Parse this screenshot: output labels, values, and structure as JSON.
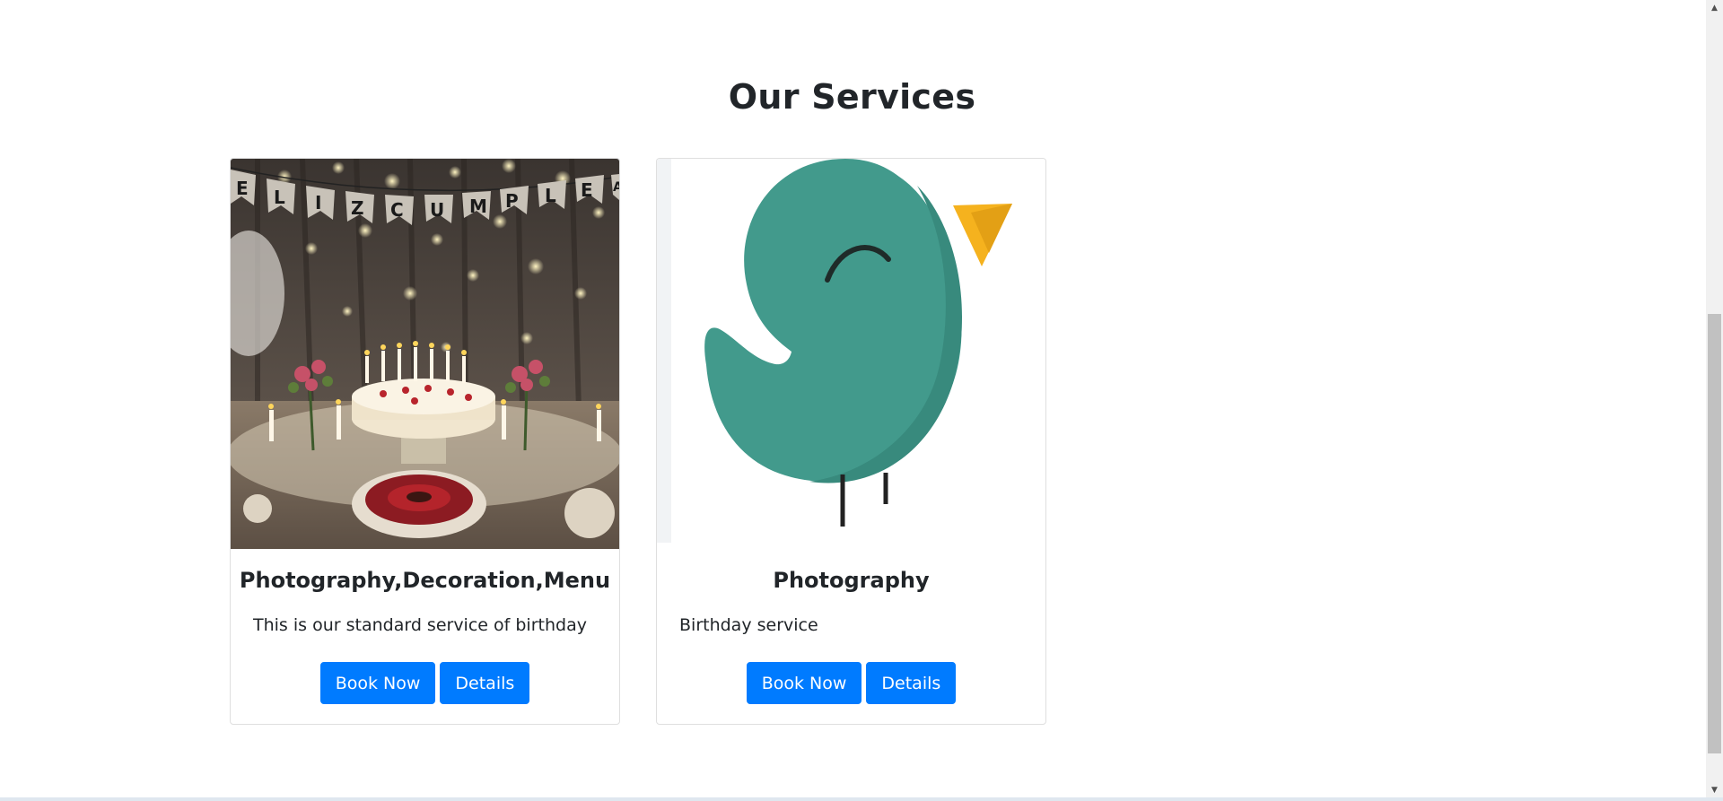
{
  "section": {
    "title": "Our Services"
  },
  "services": [
    {
      "title": "Photography,Decoration,Menu",
      "description": "This is our standard service of birthday",
      "book_label": "Book Now",
      "details_label": "Details",
      "image_banner": "ELIZCUMPLEAR"
    },
    {
      "title": "Photography",
      "description": "Birthday service",
      "book_label": "Book Now",
      "details_label": "Details"
    }
  ],
  "colors": {
    "primary": "#007bff",
    "bird": "#429a8c",
    "beak": "#f5b21e"
  },
  "icons": {
    "scroll_up": "arrow-up-icon",
    "scroll_down": "arrow-down-icon"
  }
}
